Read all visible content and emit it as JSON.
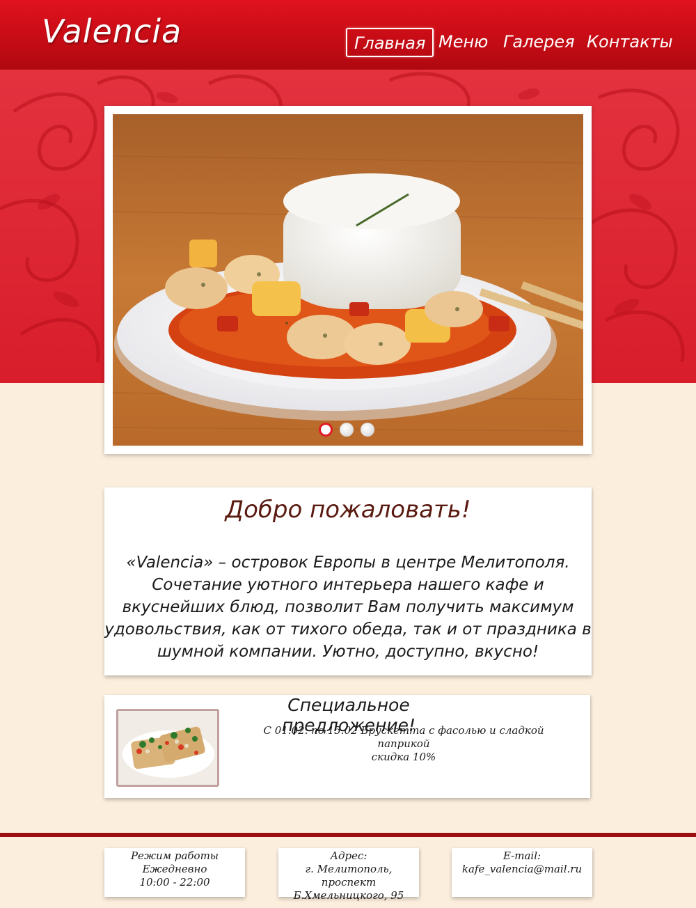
{
  "header": {
    "logo": "Valencia",
    "nav": [
      {
        "label": "Главная",
        "active": true
      },
      {
        "label": "Меню",
        "active": false
      },
      {
        "label": "Галерея",
        "active": false
      },
      {
        "label": "Контакты",
        "active": false
      }
    ]
  },
  "slider": {
    "slide_count": 3,
    "active_index": 0,
    "image": "plate of chicken in tomato sauce with rice and chopsticks"
  },
  "welcome": {
    "title": "Добро пожаловать!",
    "lines": [
      "«Valencia» – островок Европы в центре Мелитополя.",
      "Сочетание уютного интерьера нашего кафе и",
      "вкуснейших блюд, позволит Вам получить максимум",
      "удовольствия, как от тихого обеда, так и от праздника в",
      "шумной компании. Уютно, доступно, вкусно!"
    ]
  },
  "special": {
    "title": "Специальное предложение!",
    "lines": [
      "С 01.02. по 15.02 Брускетта с фасолью и сладкой паприкой",
      "скидка 10%"
    ]
  },
  "footer": {
    "hours": {
      "label": "Режим работы",
      "days": "Ежедневно",
      "time": "10:00 - 22:00"
    },
    "address": {
      "label": "Адрес:",
      "line1": "г. Мелитополь, проспект",
      "line2": "Б.Хмельницкого, 95"
    },
    "email": {
      "label": "E-mail:",
      "value": "kafe_valencia@mail.ru"
    }
  },
  "colors": {
    "header_red": "#cc0d17",
    "band_red": "#e4323f",
    "background_cream": "#fbeedd",
    "footer_line": "#9e0f14",
    "title_brown": "#5a1a10"
  }
}
